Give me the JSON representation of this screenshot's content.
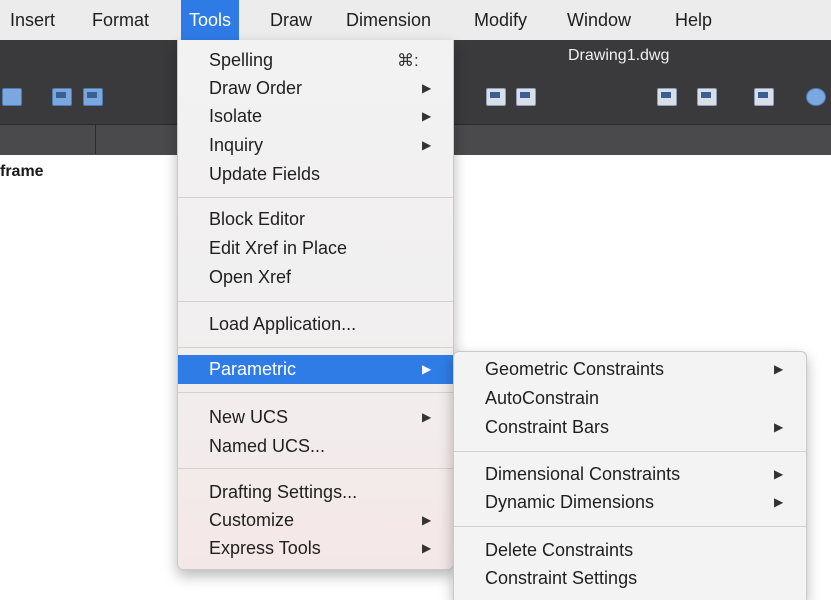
{
  "menubar": {
    "items": [
      "Insert",
      "Format",
      "Tools",
      "Draw",
      "Dimension",
      "Modify",
      "Window",
      "Help"
    ],
    "active": "Tools"
  },
  "window": {
    "title": "Drawing1.dwg"
  },
  "panel": {
    "label": "frame"
  },
  "tools_menu": {
    "spelling": "Spelling",
    "spelling_shortcut": "⌘:",
    "draw_order": "Draw Order",
    "isolate": "Isolate",
    "inquiry": "Inquiry",
    "update_fields": "Update Fields",
    "block_editor": "Block Editor",
    "edit_xref_in_place": "Edit Xref in Place",
    "open_xref": "Open Xref",
    "load_application": "Load Application...",
    "parametric": "Parametric",
    "new_ucs": "New UCS",
    "named_ucs": "Named UCS...",
    "drafting_settings": "Drafting Settings...",
    "customize": "Customize",
    "express_tools": "Express Tools",
    "highlight_color": "#2f7ce6"
  },
  "parametric_submenu": {
    "geometric_constraints": "Geometric Constraints",
    "autoconstrain": "AutoConstrain",
    "constraint_bars": "Constraint Bars",
    "dimensional_constraints": "Dimensional Constraints",
    "dynamic_dimensions": "Dynamic Dimensions",
    "delete_constraints": "Delete Constraints",
    "constraint_settings": "Constraint Settings"
  },
  "icons": {
    "submenu_arrow": "▶",
    "toolbar": [
      "save-icon",
      "save-as-icon",
      "layout-icon",
      "layout-alt-icon",
      "import-icon",
      "export-icon",
      "plot-icon",
      "publish-icon",
      "globe-icon"
    ]
  }
}
